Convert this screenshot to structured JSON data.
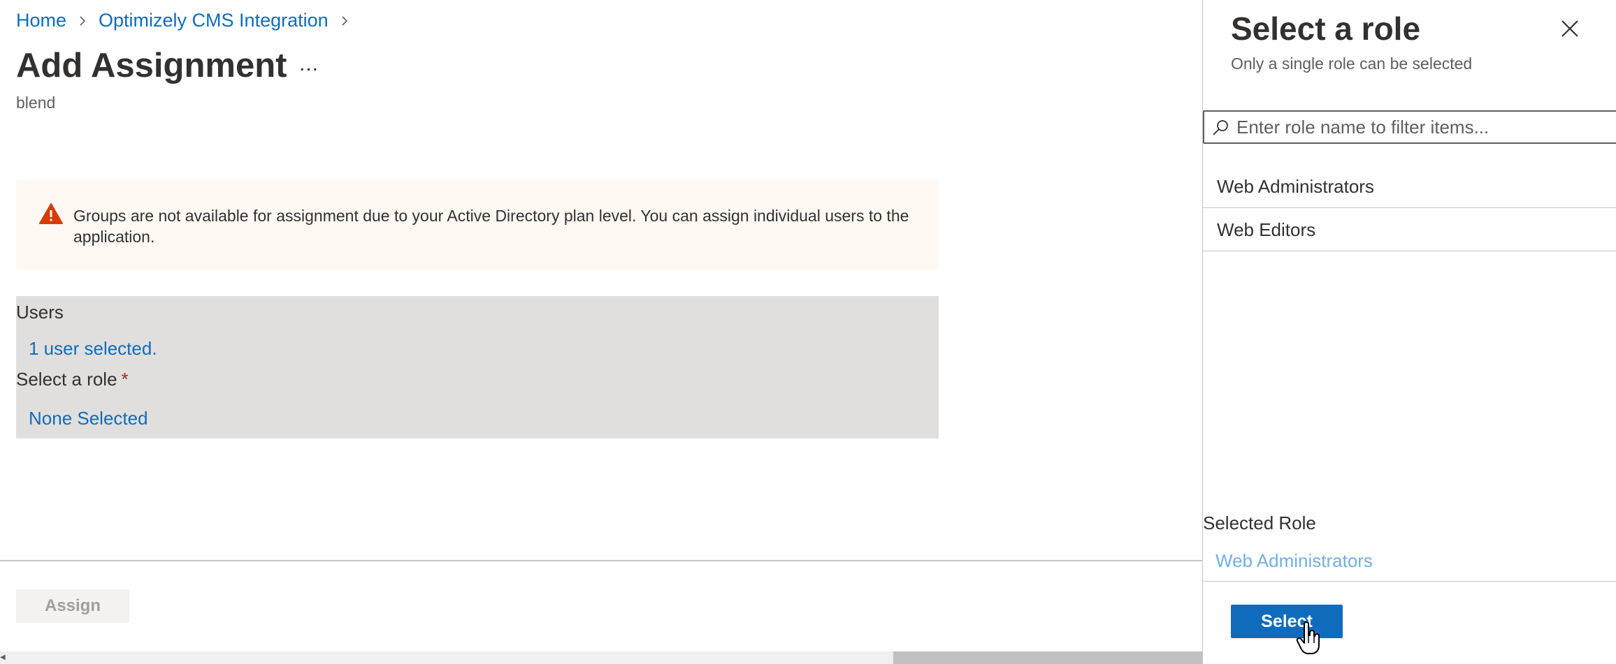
{
  "breadcrumb": {
    "items": [
      "Home",
      "Optimizely CMS Integration"
    ]
  },
  "page": {
    "title": "Add Assignment",
    "more_label": "...",
    "subtitle": "blend"
  },
  "warning": {
    "icon": "warning-icon",
    "text": "Groups are not available for assignment due to your Active Directory plan level. You can assign individual users to the application."
  },
  "assignment": {
    "users_label": "Users",
    "users_value": "1 user selected.",
    "role_label": "Select a role",
    "role_required": "*",
    "role_value": "None Selected"
  },
  "footer": {
    "assign_label": "Assign"
  },
  "panel": {
    "title": "Select a role",
    "subtitle": "Only a single role can be selected",
    "close_icon": "close-icon",
    "search_placeholder": "Enter role name to filter items...",
    "roles": [
      "Web Administrators",
      "Web Editors"
    ],
    "selected_label": "Selected Role",
    "selected_value": "Web Administrators",
    "select_label": "Select"
  },
  "colors": {
    "link": "#0f6cbd",
    "primary_button": "#0f6cbd",
    "warning_bg": "#fff8f3",
    "warning_icon": "#d83b01",
    "assignment_bg": "#e1dfdd",
    "selected_value": "#71afe5"
  }
}
